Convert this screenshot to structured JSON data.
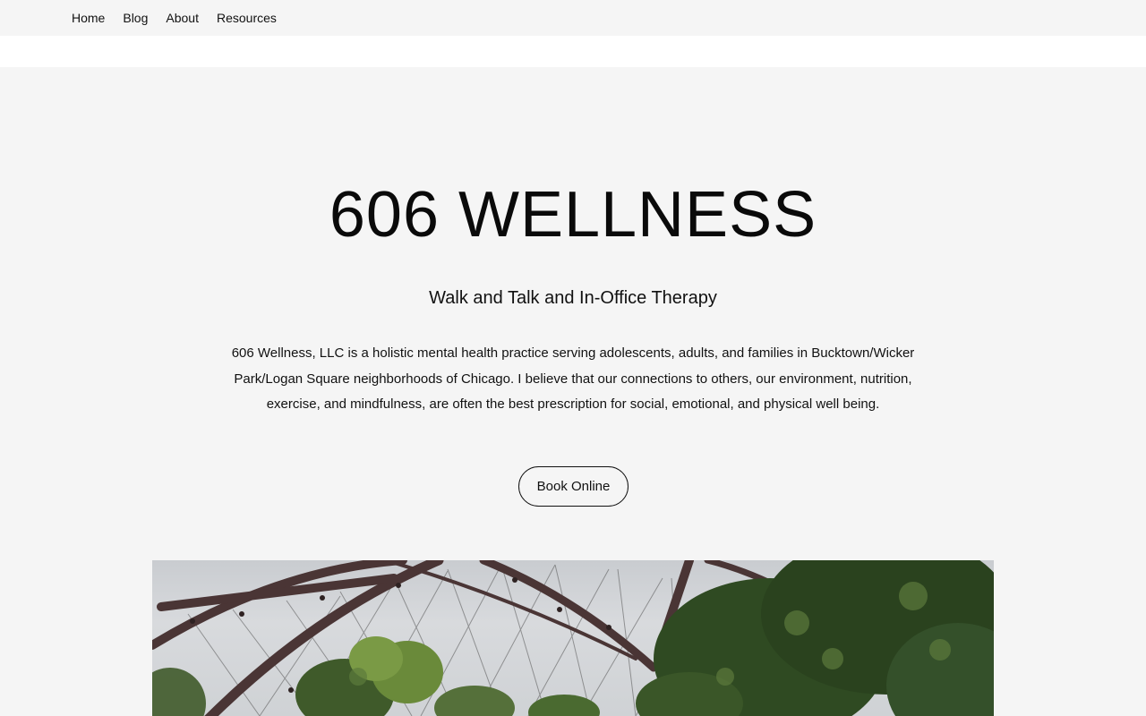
{
  "nav": {
    "items": [
      "Home",
      "Blog",
      "About",
      "Resources"
    ]
  },
  "hero": {
    "title": "606 WELLNESS",
    "subtitle": "Walk and Talk and In-Office Therapy",
    "description": "606 Wellness, LLC is a holistic mental health practice serving adolescents, adults, and families in Bucktown/Wicker Park/Logan Square neighborhoods of Chicago.  I believe that our connections to others, our environment, nutrition, exercise, and mindfulness, are often the best prescription for social, emotional, and physical well being.",
    "cta_label": "Book Online"
  },
  "colors": {
    "background": "#f5f5f5",
    "text": "#111111",
    "bridge": "#4a3535",
    "foliage": "#3f5a2a"
  }
}
